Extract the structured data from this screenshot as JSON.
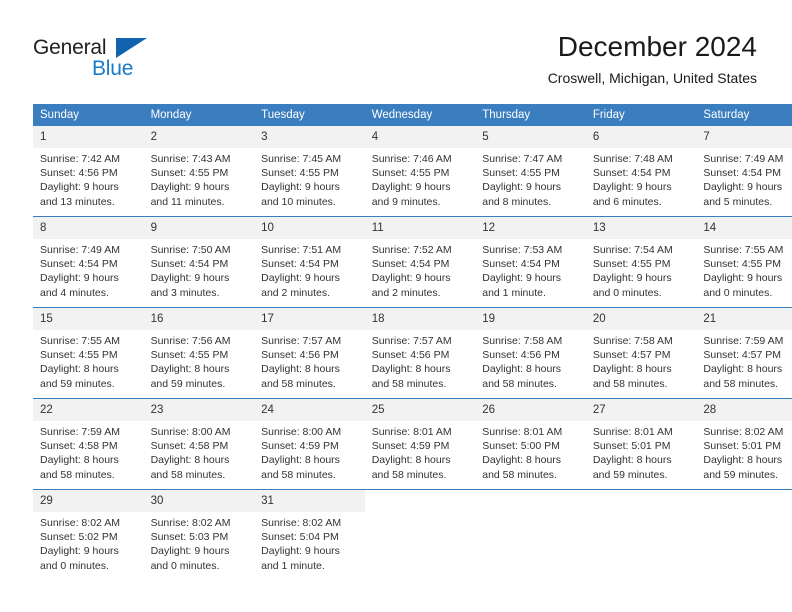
{
  "logo": {
    "word_one": "General",
    "word_two": "Blue",
    "triangle_icon": "triangle-icon",
    "brand_dark": "#231f20",
    "brand_blue": "#1b79c9"
  },
  "header": {
    "title": "December 2024",
    "subtitle": "Croswell, Michigan, United States"
  },
  "colors": {
    "header_band": "#3a7ebf",
    "daynum_background": "#f2f2f2",
    "text": "#333333"
  },
  "weekday_headers": [
    "Sunday",
    "Monday",
    "Tuesday",
    "Wednesday",
    "Thursday",
    "Friday",
    "Saturday"
  ],
  "labels": {
    "sunrise": "Sunrise:",
    "sunset": "Sunset:",
    "daylight": "Daylight:"
  },
  "weeks": [
    [
      {
        "day": "1",
        "sunrise": "Sunrise: 7:42 AM",
        "sunset": "Sunset: 4:56 PM",
        "daylight_line1": "Daylight: 9 hours",
        "daylight_line2": "and 13 minutes."
      },
      {
        "day": "2",
        "sunrise": "Sunrise: 7:43 AM",
        "sunset": "Sunset: 4:55 PM",
        "daylight_line1": "Daylight: 9 hours",
        "daylight_line2": "and 11 minutes."
      },
      {
        "day": "3",
        "sunrise": "Sunrise: 7:45 AM",
        "sunset": "Sunset: 4:55 PM",
        "daylight_line1": "Daylight: 9 hours",
        "daylight_line2": "and 10 minutes."
      },
      {
        "day": "4",
        "sunrise": "Sunrise: 7:46 AM",
        "sunset": "Sunset: 4:55 PM",
        "daylight_line1": "Daylight: 9 hours",
        "daylight_line2": "and 9 minutes."
      },
      {
        "day": "5",
        "sunrise": "Sunrise: 7:47 AM",
        "sunset": "Sunset: 4:55 PM",
        "daylight_line1": "Daylight: 9 hours",
        "daylight_line2": "and 8 minutes."
      },
      {
        "day": "6",
        "sunrise": "Sunrise: 7:48 AM",
        "sunset": "Sunset: 4:54 PM",
        "daylight_line1": "Daylight: 9 hours",
        "daylight_line2": "and 6 minutes."
      },
      {
        "day": "7",
        "sunrise": "Sunrise: 7:49 AM",
        "sunset": "Sunset: 4:54 PM",
        "daylight_line1": "Daylight: 9 hours",
        "daylight_line2": "and 5 minutes."
      }
    ],
    [
      {
        "day": "8",
        "sunrise": "Sunrise: 7:49 AM",
        "sunset": "Sunset: 4:54 PM",
        "daylight_line1": "Daylight: 9 hours",
        "daylight_line2": "and 4 minutes."
      },
      {
        "day": "9",
        "sunrise": "Sunrise: 7:50 AM",
        "sunset": "Sunset: 4:54 PM",
        "daylight_line1": "Daylight: 9 hours",
        "daylight_line2": "and 3 minutes."
      },
      {
        "day": "10",
        "sunrise": "Sunrise: 7:51 AM",
        "sunset": "Sunset: 4:54 PM",
        "daylight_line1": "Daylight: 9 hours",
        "daylight_line2": "and 2 minutes."
      },
      {
        "day": "11",
        "sunrise": "Sunrise: 7:52 AM",
        "sunset": "Sunset: 4:54 PM",
        "daylight_line1": "Daylight: 9 hours",
        "daylight_line2": "and 2 minutes."
      },
      {
        "day": "12",
        "sunrise": "Sunrise: 7:53 AM",
        "sunset": "Sunset: 4:54 PM",
        "daylight_line1": "Daylight: 9 hours",
        "daylight_line2": "and 1 minute."
      },
      {
        "day": "13",
        "sunrise": "Sunrise: 7:54 AM",
        "sunset": "Sunset: 4:55 PM",
        "daylight_line1": "Daylight: 9 hours",
        "daylight_line2": "and 0 minutes."
      },
      {
        "day": "14",
        "sunrise": "Sunrise: 7:55 AM",
        "sunset": "Sunset: 4:55 PM",
        "daylight_line1": "Daylight: 9 hours",
        "daylight_line2": "and 0 minutes."
      }
    ],
    [
      {
        "day": "15",
        "sunrise": "Sunrise: 7:55 AM",
        "sunset": "Sunset: 4:55 PM",
        "daylight_line1": "Daylight: 8 hours",
        "daylight_line2": "and 59 minutes."
      },
      {
        "day": "16",
        "sunrise": "Sunrise: 7:56 AM",
        "sunset": "Sunset: 4:55 PM",
        "daylight_line1": "Daylight: 8 hours",
        "daylight_line2": "and 59 minutes."
      },
      {
        "day": "17",
        "sunrise": "Sunrise: 7:57 AM",
        "sunset": "Sunset: 4:56 PM",
        "daylight_line1": "Daylight: 8 hours",
        "daylight_line2": "and 58 minutes."
      },
      {
        "day": "18",
        "sunrise": "Sunrise: 7:57 AM",
        "sunset": "Sunset: 4:56 PM",
        "daylight_line1": "Daylight: 8 hours",
        "daylight_line2": "and 58 minutes."
      },
      {
        "day": "19",
        "sunrise": "Sunrise: 7:58 AM",
        "sunset": "Sunset: 4:56 PM",
        "daylight_line1": "Daylight: 8 hours",
        "daylight_line2": "and 58 minutes."
      },
      {
        "day": "20",
        "sunrise": "Sunrise: 7:58 AM",
        "sunset": "Sunset: 4:57 PM",
        "daylight_line1": "Daylight: 8 hours",
        "daylight_line2": "and 58 minutes."
      },
      {
        "day": "21",
        "sunrise": "Sunrise: 7:59 AM",
        "sunset": "Sunset: 4:57 PM",
        "daylight_line1": "Daylight: 8 hours",
        "daylight_line2": "and 58 minutes."
      }
    ],
    [
      {
        "day": "22",
        "sunrise": "Sunrise: 7:59 AM",
        "sunset": "Sunset: 4:58 PM",
        "daylight_line1": "Daylight: 8 hours",
        "daylight_line2": "and 58 minutes."
      },
      {
        "day": "23",
        "sunrise": "Sunrise: 8:00 AM",
        "sunset": "Sunset: 4:58 PM",
        "daylight_line1": "Daylight: 8 hours",
        "daylight_line2": "and 58 minutes."
      },
      {
        "day": "24",
        "sunrise": "Sunrise: 8:00 AM",
        "sunset": "Sunset: 4:59 PM",
        "daylight_line1": "Daylight: 8 hours",
        "daylight_line2": "and 58 minutes."
      },
      {
        "day": "25",
        "sunrise": "Sunrise: 8:01 AM",
        "sunset": "Sunset: 4:59 PM",
        "daylight_line1": "Daylight: 8 hours",
        "daylight_line2": "and 58 minutes."
      },
      {
        "day": "26",
        "sunrise": "Sunrise: 8:01 AM",
        "sunset": "Sunset: 5:00 PM",
        "daylight_line1": "Daylight: 8 hours",
        "daylight_line2": "and 58 minutes."
      },
      {
        "day": "27",
        "sunrise": "Sunrise: 8:01 AM",
        "sunset": "Sunset: 5:01 PM",
        "daylight_line1": "Daylight: 8 hours",
        "daylight_line2": "and 59 minutes."
      },
      {
        "day": "28",
        "sunrise": "Sunrise: 8:02 AM",
        "sunset": "Sunset: 5:01 PM",
        "daylight_line1": "Daylight: 8 hours",
        "daylight_line2": "and 59 minutes."
      }
    ],
    [
      {
        "day": "29",
        "sunrise": "Sunrise: 8:02 AM",
        "sunset": "Sunset: 5:02 PM",
        "daylight_line1": "Daylight: 9 hours",
        "daylight_line2": "and 0 minutes."
      },
      {
        "day": "30",
        "sunrise": "Sunrise: 8:02 AM",
        "sunset": "Sunset: 5:03 PM",
        "daylight_line1": "Daylight: 9 hours",
        "daylight_line2": "and 0 minutes."
      },
      {
        "day": "31",
        "sunrise": "Sunrise: 8:02 AM",
        "sunset": "Sunset: 5:04 PM",
        "daylight_line1": "Daylight: 9 hours",
        "daylight_line2": "and 1 minute."
      },
      {
        "day": "",
        "sunrise": "",
        "sunset": "",
        "daylight_line1": "",
        "daylight_line2": ""
      },
      {
        "day": "",
        "sunrise": "",
        "sunset": "",
        "daylight_line1": "",
        "daylight_line2": ""
      },
      {
        "day": "",
        "sunrise": "",
        "sunset": "",
        "daylight_line1": "",
        "daylight_line2": ""
      },
      {
        "day": "",
        "sunrise": "",
        "sunset": "",
        "daylight_line1": "",
        "daylight_line2": ""
      }
    ]
  ]
}
